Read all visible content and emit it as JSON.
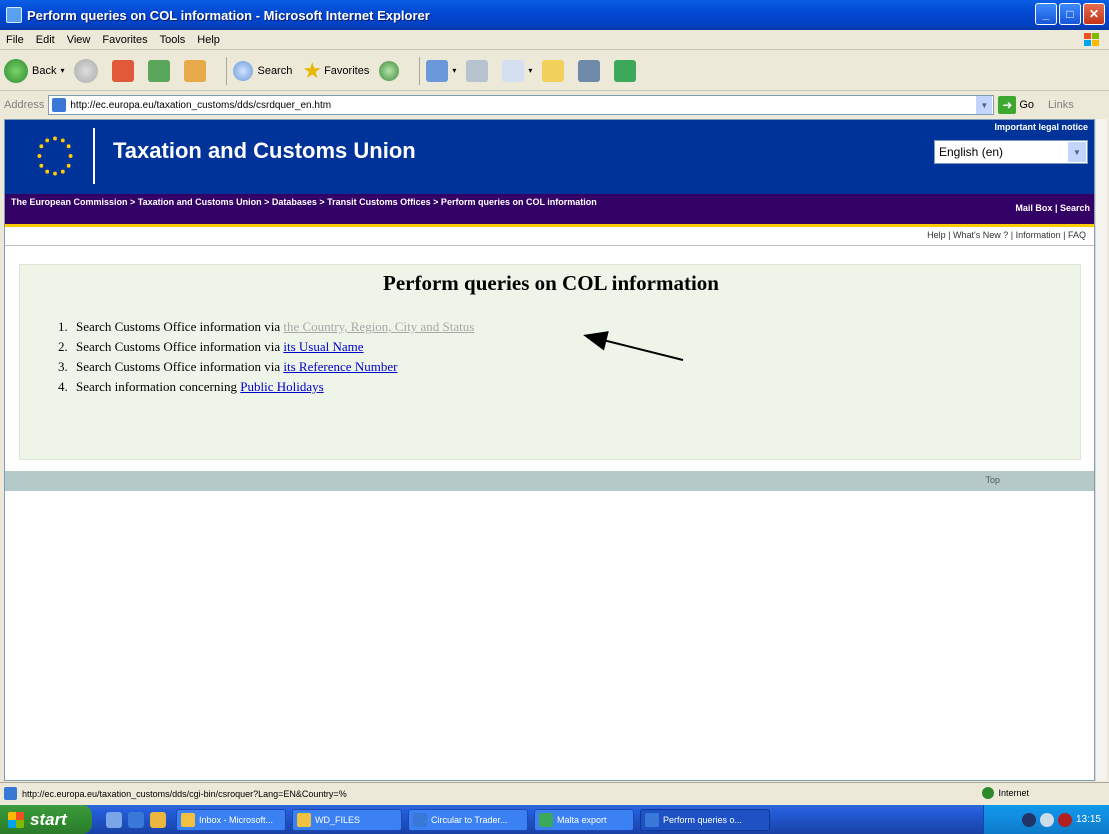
{
  "window": {
    "title": "Perform queries on COL information - Microsoft Internet Explorer",
    "controls": [
      "minimize",
      "maximize",
      "close"
    ]
  },
  "menubar": {
    "items": [
      "File",
      "Edit",
      "View",
      "Favorites",
      "Tools",
      "Help"
    ]
  },
  "toolbar": {
    "back_label": "Back",
    "search_label": "Search",
    "favorites_label": "Favorites"
  },
  "addressbar": {
    "label": "Address",
    "url": "http://ec.europa.eu/taxation_customs/dds/csrdquer_en.htm",
    "go_label": "Go",
    "links_label": "Links"
  },
  "site": {
    "title": "Taxation and Customs Union",
    "legal_notice": "Important legal notice",
    "language": "English (en)",
    "breadcrumb": "The European Commission > Taxation and Customs Union > Databases > Transit Customs Offices > Perform queries on COL information",
    "mailbox": "Mail Box",
    "search": "Search",
    "util_links": [
      "Help",
      "What's New ?",
      "Information",
      "FAQ"
    ],
    "top_link": "Top"
  },
  "content": {
    "heading": "Perform queries on COL information",
    "items": [
      {
        "num": "1.",
        "text": "Search Customs Office information via ",
        "link": "the Country, Region, City and Status",
        "visited": true
      },
      {
        "num": "2.",
        "text": "Search Customs Office information via ",
        "link": "its Usual Name",
        "visited": false
      },
      {
        "num": "3.",
        "text": "Search Customs Office information via ",
        "link": "its Reference Number",
        "visited": false
      },
      {
        "num": "4.",
        "text": "Search information concerning ",
        "link": "Public Holidays",
        "visited": false
      }
    ]
  },
  "statusbar": {
    "text": "http://ec.europa.eu/taxation_customs/dds/cgi-bin/csroquer?Lang=EN&Country=%",
    "zone": "Internet"
  },
  "taskbar": {
    "start_label": "start",
    "tasks": [
      {
        "label": "Inbox - Microsoft...",
        "active": false
      },
      {
        "label": "WD_FILES",
        "active": false
      },
      {
        "label": "Circular to Trader...",
        "active": false
      },
      {
        "label": "Malta export",
        "active": false
      },
      {
        "label": "Perform queries o...",
        "active": true
      }
    ],
    "clock": "13:15"
  },
  "colors": {
    "header_blue": "#003399",
    "breadcrumb_purple": "#330066",
    "content_bg": "#eef5e8",
    "footer_bar": "#b5cac8"
  }
}
